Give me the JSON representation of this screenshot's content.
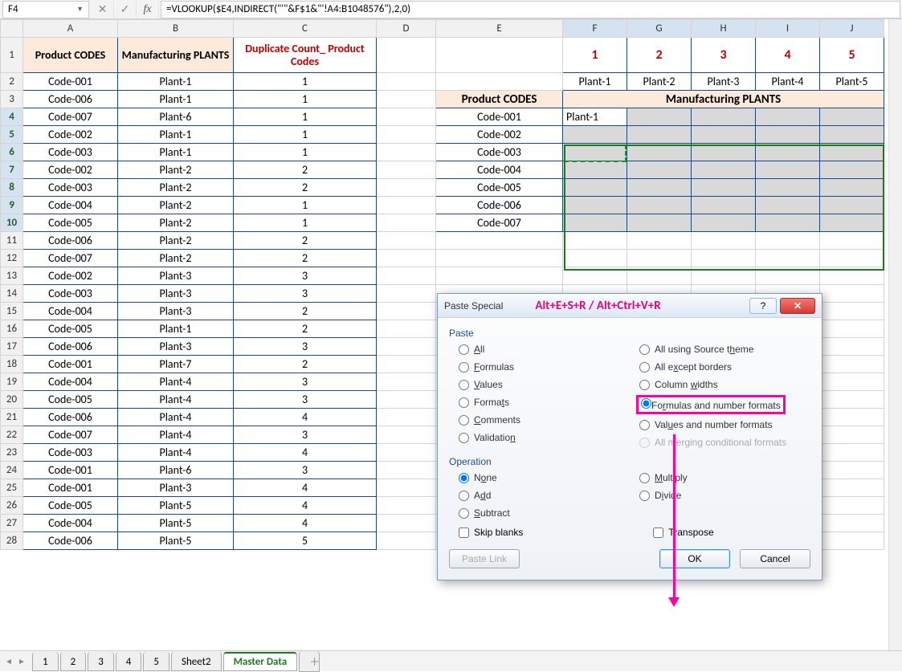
{
  "nameBox": "F4",
  "formula": "=VLOOKUP($E4,INDIRECT(\"'\"&F$1&\"'!A4:B1048576\"),2,0)",
  "columns": [
    "A",
    "B",
    "C",
    "D",
    "E",
    "F",
    "G",
    "H",
    "I",
    "J"
  ],
  "headers": {
    "A": "Product CODES",
    "B": "Manufacturing PLANTS",
    "C": "Duplicate Count_ Product Codes",
    "E3": "Product CODES",
    "FJ3": "Manufacturing PLANTS"
  },
  "redNums": [
    "1",
    "2",
    "3",
    "4",
    "5"
  ],
  "plantsRow": [
    "Plant-1",
    "Plant-2",
    "Plant-3",
    "Plant-4",
    "Plant-5"
  ],
  "leftRows": [
    [
      "Code-001",
      "Plant-1",
      "1"
    ],
    [
      "Code-006",
      "Plant-1",
      "1"
    ],
    [
      "Code-007",
      "Plant-6",
      "1"
    ],
    [
      "Code-002",
      "Plant-1",
      "1"
    ],
    [
      "Code-003",
      "Plant-1",
      "1"
    ],
    [
      "Code-002",
      "Plant-2",
      "2"
    ],
    [
      "Code-003",
      "Plant-2",
      "2"
    ],
    [
      "Code-004",
      "Plant-2",
      "1"
    ],
    [
      "Code-005",
      "Plant-2",
      "1"
    ],
    [
      "Code-006",
      "Plant-2",
      "2"
    ],
    [
      "Code-007",
      "Plant-2",
      "2"
    ],
    [
      "Code-002",
      "Plant-3",
      "3"
    ],
    [
      "Code-003",
      "Plant-3",
      "3"
    ],
    [
      "Code-004",
      "Plant-3",
      "2"
    ],
    [
      "Code-005",
      "Plant-1",
      "2"
    ],
    [
      "Code-006",
      "Plant-3",
      "3"
    ],
    [
      "Code-001",
      "Plant-7",
      "2"
    ],
    [
      "Code-004",
      "Plant-4",
      "3"
    ],
    [
      "Code-005",
      "Plant-4",
      "3"
    ],
    [
      "Code-006",
      "Plant-4",
      "4"
    ],
    [
      "Code-007",
      "Plant-4",
      "3"
    ],
    [
      "Code-003",
      "Plant-4",
      "4"
    ],
    [
      "Code-001",
      "Plant-6",
      "3"
    ],
    [
      "Code-001",
      "Plant-3",
      "4"
    ],
    [
      "Code-005",
      "Plant-5",
      "4"
    ],
    [
      "Code-004",
      "Plant-5",
      "4"
    ],
    [
      "Code-006",
      "Plant-5",
      "5"
    ]
  ],
  "colE": [
    "Code-001",
    "Code-002",
    "Code-003",
    "Code-004",
    "Code-005",
    "Code-006",
    "Code-007"
  ],
  "f4": "Plant-1",
  "sheetTabs": [
    "1",
    "2",
    "3",
    "4",
    "5",
    "Sheet2",
    "Master Data"
  ],
  "activeTab": "Master Data",
  "dialog": {
    "title": "Paste Special",
    "shortcut": "Alt+E+S+R  / Alt+Ctrl+V+R",
    "groupPaste": "Paste",
    "groupOp": "Operation",
    "pasteLeft": [
      "All",
      "Formulas",
      "Values",
      "Formats",
      "Comments",
      "Validation"
    ],
    "pasteLeftKeys": [
      "A",
      "F",
      "V",
      "T",
      "C",
      "N"
    ],
    "pasteRight": [
      "All using Source theme",
      "All except borders",
      "Column widths",
      "Formulas and number formats",
      "Values and number formats",
      "All merging conditional formats"
    ],
    "pasteRightDisabled": [
      false,
      false,
      false,
      false,
      false,
      true
    ],
    "opLeft": [
      "None",
      "Add",
      "Subtract"
    ],
    "opRight": [
      "Multiply",
      "Divide"
    ],
    "skip": "Skip blanks",
    "transpose": "Transpose",
    "pasteLink": "Paste Link",
    "ok": "OK",
    "cancel": "Cancel"
  }
}
